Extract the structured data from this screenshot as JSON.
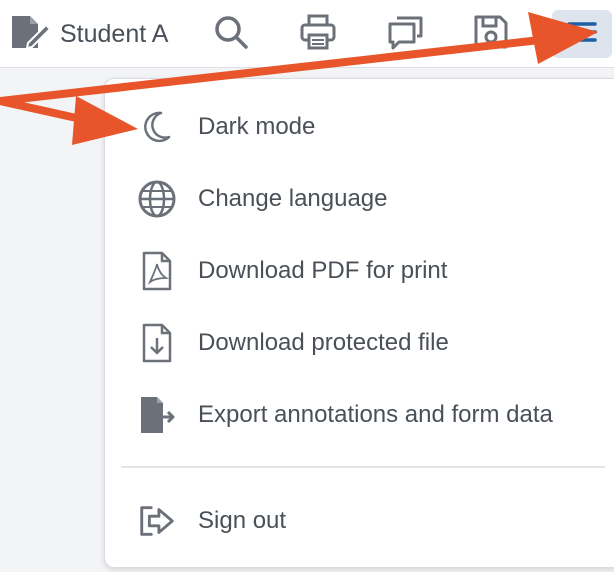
{
  "toolbar": {
    "user_name": "Student A",
    "buttons": [
      {
        "icon": "search-icon"
      },
      {
        "icon": "print-icon"
      },
      {
        "icon": "comments-icon"
      },
      {
        "icon": "save-icon"
      },
      {
        "icon": "hamburger-menu-icon",
        "active": true
      }
    ]
  },
  "menu": {
    "items": [
      {
        "label": "Dark mode",
        "icon": "moon-icon"
      },
      {
        "label": "Change language",
        "icon": "globe-icon"
      },
      {
        "label": "Download PDF for print",
        "icon": "pdf-file-icon"
      },
      {
        "label": "Download protected file",
        "icon": "file-download-icon"
      },
      {
        "label": "Export annotations and form data",
        "icon": "file-export-icon"
      }
    ],
    "sign_out": {
      "label": "Sign out",
      "icon": "sign-out-icon"
    }
  },
  "colors": {
    "icon": "#6b7079",
    "text": "#4a5058",
    "active_bg": "#dde4ee",
    "menu_icon_active": "#1f5fa6",
    "annotation_arrow": "#e8552b"
  }
}
